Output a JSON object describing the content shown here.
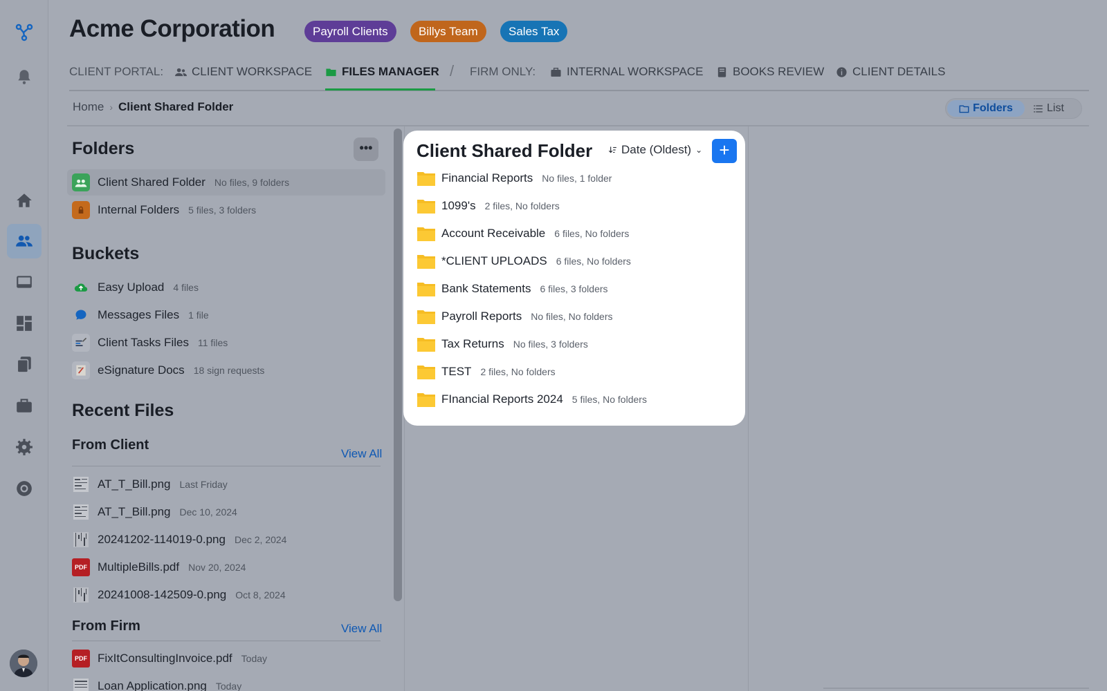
{
  "header": {
    "title": "Acme Corporation",
    "tags": [
      {
        "label": "Payroll Clients",
        "color": "#5e3d97"
      },
      {
        "label": "Billys Team",
        "color": "#c0661c"
      },
      {
        "label": "Sales Tax",
        "color": "#1774b5"
      }
    ]
  },
  "tabs": {
    "client_portal_label": "CLIENT PORTAL:",
    "client_workspace": "CLIENT WORKSPACE",
    "files_manager": "FILES MANAGER",
    "separator": "/",
    "firm_only_label": "FIRM ONLY:",
    "internal_workspace": "INTERNAL WORKSPACE",
    "books_review": "BOOKS REVIEW",
    "client_details": "CLIENT DETAILS"
  },
  "breadcrumb": {
    "home": "Home",
    "current": "Client Shared Folder"
  },
  "view_toggle": {
    "folders": "Folders",
    "list": "List",
    "selected": "Folders"
  },
  "left_panel": {
    "folders_heading": "Folders",
    "more_label": "•••",
    "folders": [
      {
        "name": "Client Shared Folder",
        "meta": "No files, 9 folders",
        "icon": "users-folder-icon"
      },
      {
        "name": "Internal Folders",
        "meta": "5 files, 3 folders",
        "icon": "lock-folder-icon"
      }
    ],
    "buckets_heading": "Buckets",
    "buckets": [
      {
        "name": "Easy Upload",
        "meta": "4 files",
        "icon": "cloud-upload-icon"
      },
      {
        "name": "Messages Files",
        "meta": "1 file",
        "icon": "chat-bubble-icon"
      },
      {
        "name": "Client Tasks Files",
        "meta": "11 files",
        "icon": "tasks-icon"
      },
      {
        "name": "eSignature Docs",
        "meta": "18 sign requests",
        "icon": "signature-icon"
      }
    ],
    "recent_heading": "Recent Files",
    "from_client_heading": "From Client",
    "view_all": "View All",
    "from_client": [
      {
        "name": "AT_T_Bill.png",
        "meta": "Last Friday",
        "type": "image"
      },
      {
        "name": "AT_T_Bill.png",
        "meta": "Dec 10, 2024",
        "type": "image"
      },
      {
        "name": "20241202-114019-0.png",
        "meta": "Dec 2, 2024",
        "type": "image"
      },
      {
        "name": "MultipleBills.pdf",
        "meta": "Nov 20, 2024",
        "type": "pdf"
      },
      {
        "name": "20241008-142509-0.png",
        "meta": "Oct 8, 2024",
        "type": "image"
      }
    ],
    "from_firm_heading": "From Firm",
    "from_firm": [
      {
        "name": "FixItConsultingInvoice.pdf",
        "meta": "Today",
        "type": "pdf"
      },
      {
        "name": "Loan Application.png",
        "meta": "Today",
        "type": "image"
      }
    ],
    "pdf_badge": "PDF"
  },
  "main": {
    "title": "Client Shared Folder",
    "sort_label": "Date (Oldest)",
    "add_label": "+",
    "folders": [
      {
        "name": "Financial Reports",
        "meta": "No files, 1 folder"
      },
      {
        "name": "1099's",
        "meta": "2 files, No folders"
      },
      {
        "name": "Account Receivable",
        "meta": "6 files, No folders"
      },
      {
        "name": "*CLIENT UPLOADS",
        "meta": "6 files, No folders"
      },
      {
        "name": "Bank Statements",
        "meta": "6 files, 3 folders"
      },
      {
        "name": "Payroll Reports",
        "meta": "No files, No folders"
      },
      {
        "name": "Tax Returns",
        "meta": "No files, 3 folders"
      },
      {
        "name": "TEST",
        "meta": "2 files, No folders"
      },
      {
        "name": "FInancial Reports 2024",
        "meta": "5 files, No folders"
      }
    ]
  },
  "colors": {
    "accent": "#1976f0",
    "active_tab": "#1b9a44",
    "folder": "#f6bd24"
  }
}
